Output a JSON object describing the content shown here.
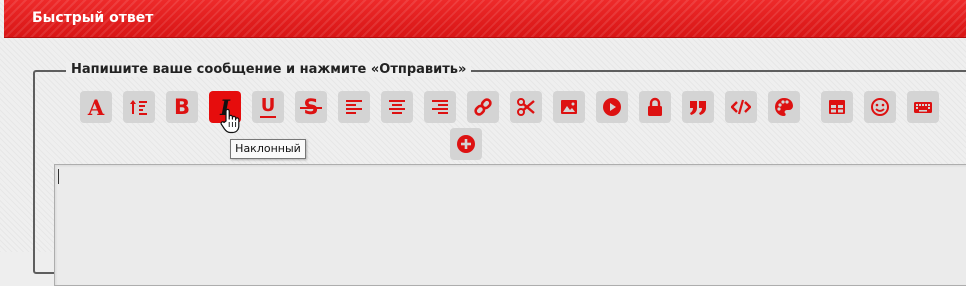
{
  "header": {
    "title": "Быстрый ответ"
  },
  "form": {
    "legend": "Напишите ваше сообщение и нажмите «Отправить»"
  },
  "toolbar": {
    "font_glyph": "A",
    "bold_glyph": "B",
    "italic_glyph": "I",
    "underline_glyph": "U",
    "strike_glyph": "S",
    "active_button": "italic"
  },
  "tooltip": {
    "text": "Наклонный"
  },
  "editor": {
    "value": ""
  },
  "colors": {
    "accent": "#e41b1b",
    "button_bg": "#d4d4d4",
    "icon": "#dd1111",
    "active_bg": "#e60d0d"
  }
}
